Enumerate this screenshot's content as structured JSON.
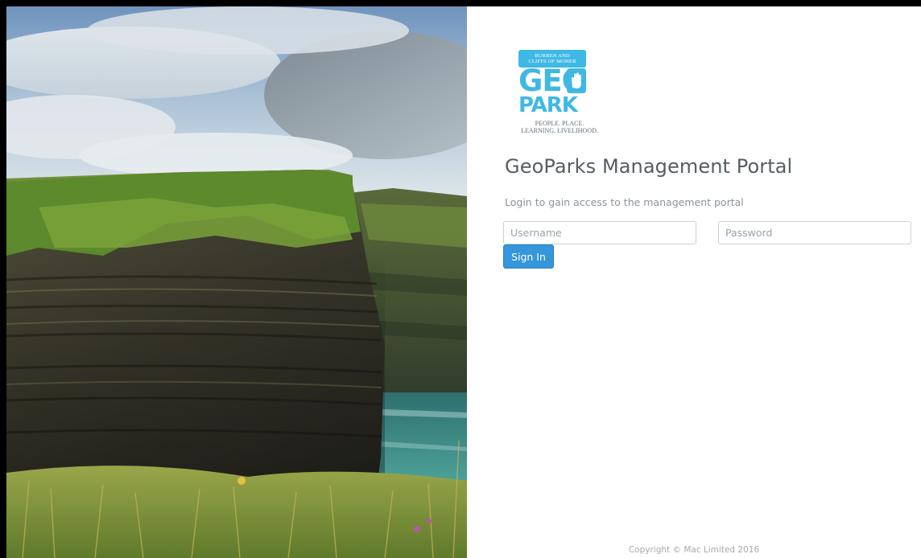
{
  "hero": {
    "image_description": "Cliffs of Moher coastal cliffs with sea and grassy foreground"
  },
  "logo": {
    "top_text_line1": "BURREN AND",
    "top_text_line2": "CLIFFS OF MOHER",
    "word1": "GEO",
    "word2": "PARK",
    "tagline_line1": "PEOPLE. PLACE.",
    "tagline_line2": "LEARNING. LIVELIHOOD.",
    "brand_color": "#3fb8e5"
  },
  "login": {
    "title": "GeoParks Management Portal",
    "subtitle": "Login to gain access to the management portal",
    "username": {
      "value": "",
      "placeholder": "Username"
    },
    "password": {
      "value": "",
      "placeholder": "Password"
    },
    "signin_label": "Sign In",
    "button_color": "#3596db"
  },
  "footer": {
    "copyright": "Copyright © Mac Limited 2016"
  }
}
